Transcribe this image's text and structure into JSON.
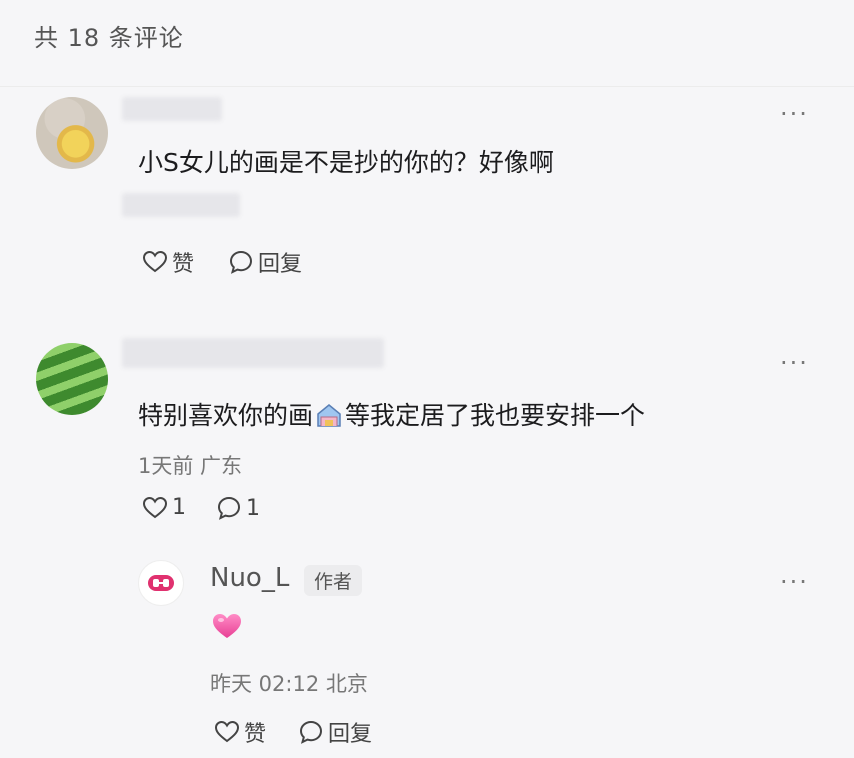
{
  "header": {
    "title": "共 18 条评论"
  },
  "comments": [
    {
      "text": "小S女儿的画是不是抄的你的？好像啊",
      "actions": {
        "like": "赞",
        "reply": "回复"
      },
      "more": "···"
    },
    {
      "text_before": "特别喜欢你的画",
      "text_after": "等我定居了我也要安排一个",
      "meta": "1天前 广东",
      "actions": {
        "like": "1",
        "reply": "1"
      },
      "more": "···"
    }
  ],
  "reply": {
    "author": "Nuo_L",
    "badge": "作者",
    "meta": "昨天 02:12 北京",
    "actions": {
      "like": "赞",
      "reply": "回复"
    },
    "more": "···"
  },
  "colors": {
    "background": "#f6f6f8",
    "heart": "#f25aa8",
    "text": "#1c1c1e",
    "meta": "#777777"
  }
}
